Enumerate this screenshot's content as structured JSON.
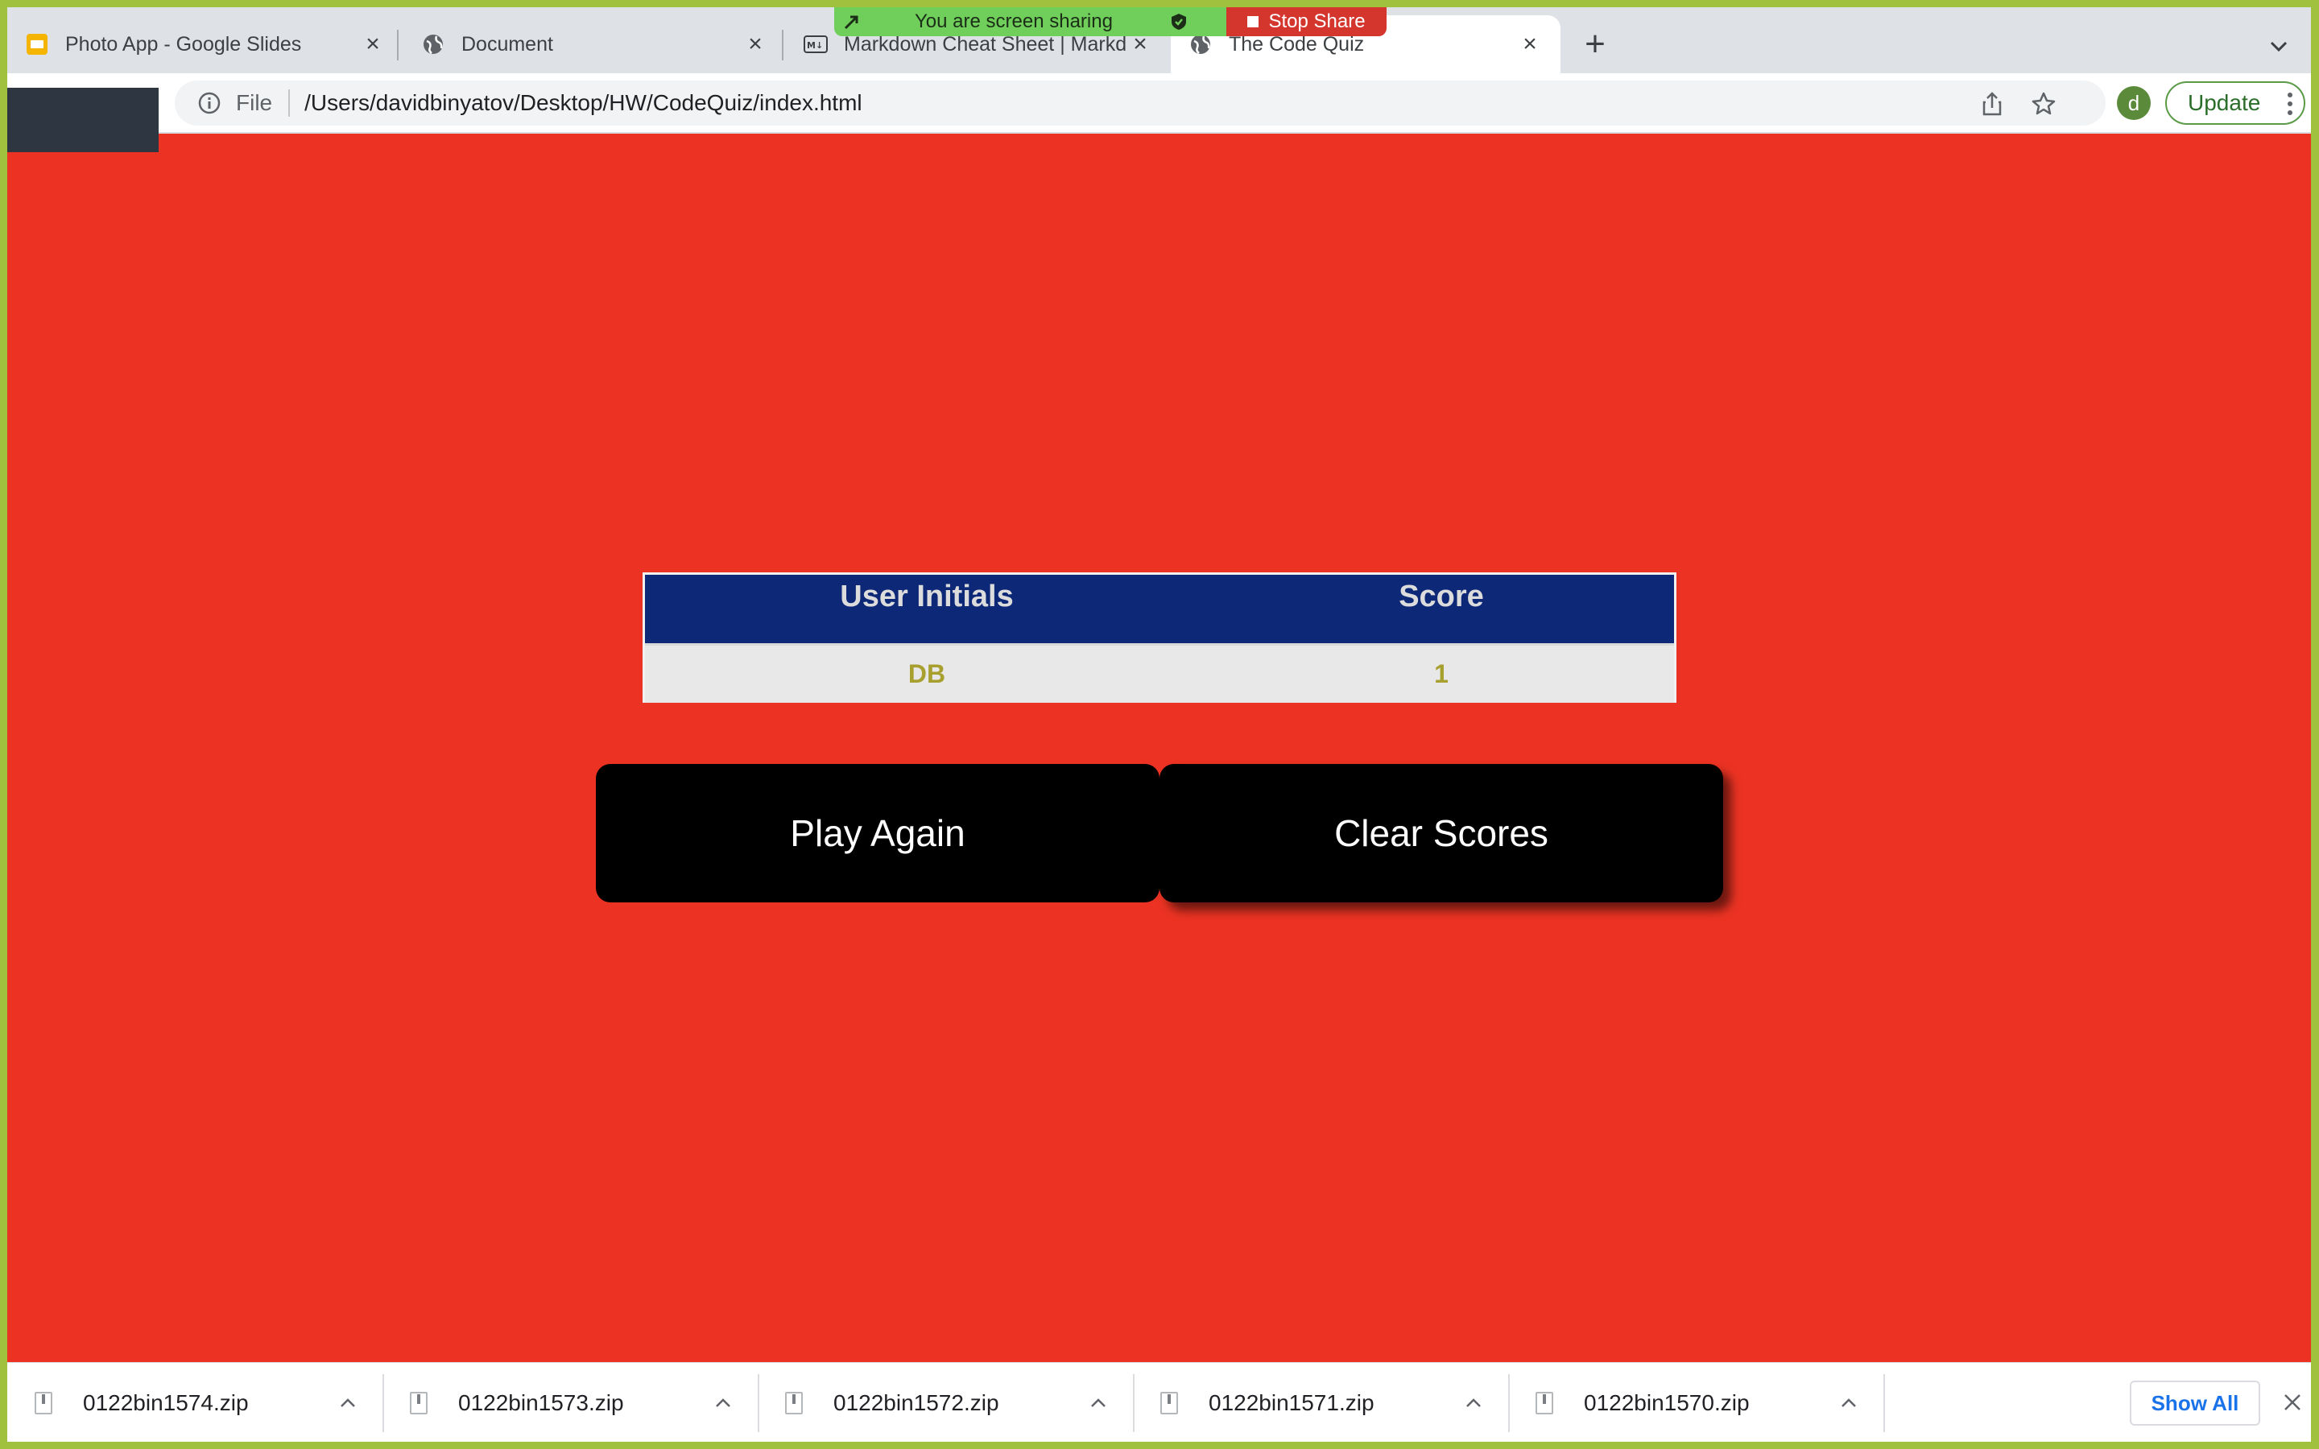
{
  "tabs": [
    {
      "title": "Photo App - Google Slides",
      "icon": "slides-icon",
      "active": false
    },
    {
      "title": "Document",
      "icon": "globe-icon",
      "active": false
    },
    {
      "title": "Markdown Cheat Sheet | Markdown Guide",
      "icon": "markdown-icon",
      "active": false
    },
    {
      "title": "The Code Quiz",
      "icon": "globe-icon",
      "active": true
    }
  ],
  "screen_share": {
    "message": "You are screen sharing",
    "stop_label": "Stop Share"
  },
  "toolbar": {
    "scheme": "File",
    "url": "/Users/davidbinyatov/Desktop/HW/CodeQuiz/index.html",
    "avatar_letter": "d",
    "update_label": "Update"
  },
  "scores_table": {
    "headers": [
      "User Initials",
      "Score"
    ],
    "rows": [
      {
        "initials": "DB",
        "score": "1"
      }
    ]
  },
  "buttons": {
    "play_again": "Play Again",
    "clear_scores": "Clear Scores"
  },
  "downloads": {
    "items": [
      "0122bin1574.zip",
      "0122bin1573.zip",
      "0122bin1572.zip",
      "0122bin1571.zip",
      "0122bin1570.zip"
    ],
    "show_all_label": "Show All"
  },
  "colors": {
    "page_background": "#ec3323",
    "table_header": "#0c2877",
    "table_row_text": "#a8a02e",
    "window_border": "#9fc13e"
  }
}
